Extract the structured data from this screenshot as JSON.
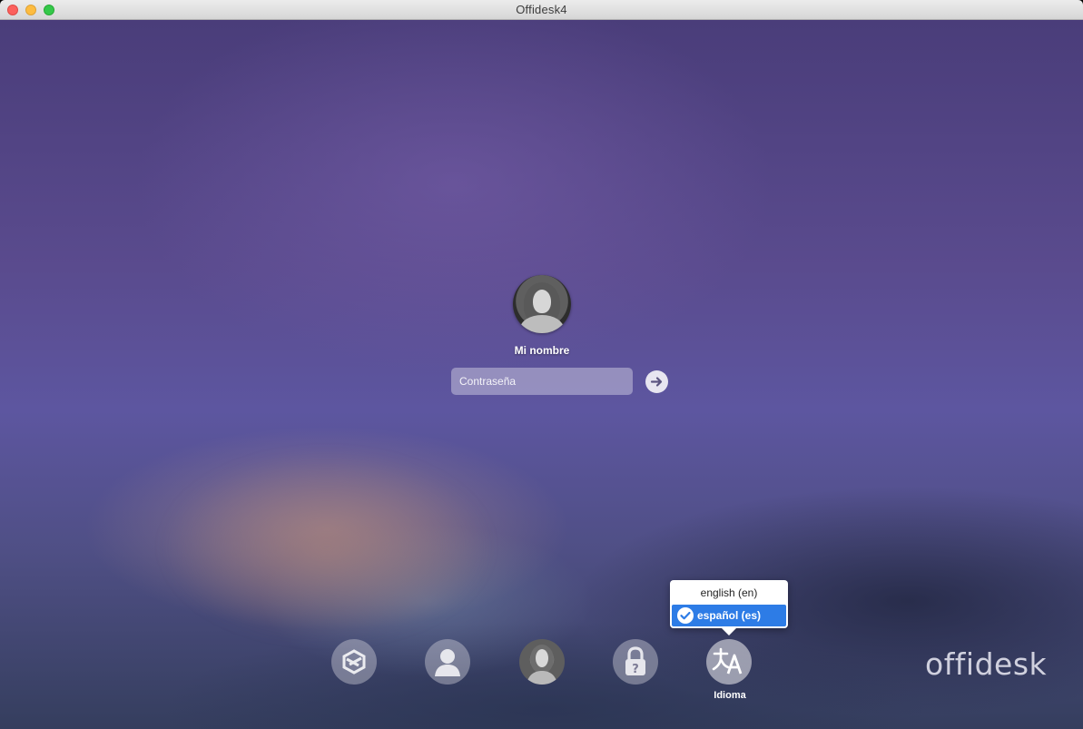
{
  "window": {
    "title": "Offidesk4"
  },
  "login": {
    "user_name": "Mi nombre",
    "password": {
      "placeholder": "Contraseña",
      "value": ""
    }
  },
  "language_menu": {
    "items": [
      {
        "label": "english (en)",
        "selected": false
      },
      {
        "label": "español (es)",
        "selected": true
      }
    ],
    "selection_color": "#2d7ce6"
  },
  "dock": {
    "buttons": [
      {
        "icon": "offidesk-logo-icon"
      },
      {
        "icon": "person-icon"
      },
      {
        "icon": "user-avatar-icon"
      },
      {
        "icon": "lock-question-icon"
      },
      {
        "icon": "translate-icon",
        "label": "Idioma"
      }
    ]
  },
  "brand": {
    "logo_text": "offidesk"
  }
}
